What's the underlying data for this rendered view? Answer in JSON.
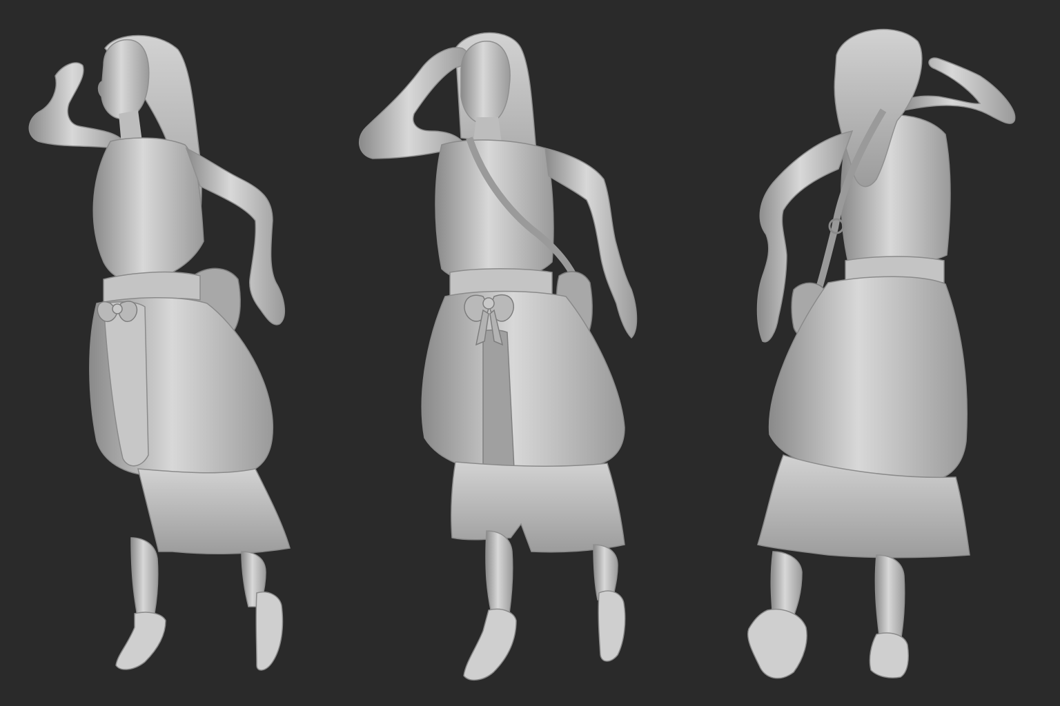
{
  "scene": {
    "background_color": "#2a2a2a",
    "material_light": "#d6d6d6",
    "material_mid": "#b4b4b4",
    "material_dark": "#7c7c7c",
    "views": [
      {
        "view": "three-quarter-left"
      },
      {
        "view": "front"
      },
      {
        "view": "back"
      }
    ]
  }
}
